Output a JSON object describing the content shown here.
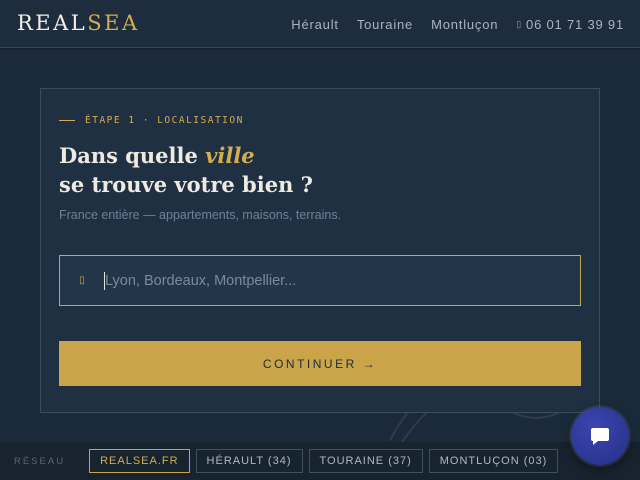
{
  "header": {
    "logo_main": "REAL",
    "logo_accent": "SEA",
    "nav": [
      "Hérault",
      "Touraine",
      "Montluçon"
    ],
    "phone": "06 01 71 39 91",
    "phone_icon": "phone-icon"
  },
  "card": {
    "step_label": "ÉTAPE 1 · LOCALISATION",
    "title_line1_pre": "Dans quelle ",
    "title_line1_em": "ville",
    "title_line2": "se trouve votre bien ?",
    "subtitle": "France entière — appartements, maisons, terrains.",
    "input_placeholder": "Lyon, Bordeaux, Montpellier...",
    "input_value": "",
    "input_icon": "map-pin-icon",
    "button_label": "CONTINUER →"
  },
  "footer": {
    "label": "RÉSEAU",
    "chips": [
      "REALSEA.FR",
      "HÉRAULT (34)",
      "TOURAINE (37)",
      "MONTLUÇON (03)"
    ]
  },
  "colors": {
    "accent": "#c9a448",
    "background": "#1b2a3a",
    "chat": "#2d37a0"
  }
}
